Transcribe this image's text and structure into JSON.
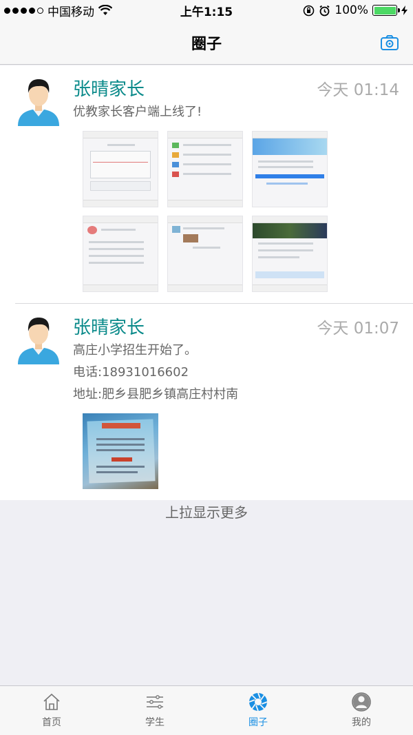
{
  "status_bar": {
    "carrier": "中国移动",
    "time": "上午1:15",
    "battery": "100%"
  },
  "nav": {
    "title": "圈子",
    "camera_icon": "camera-icon"
  },
  "posts": [
    {
      "author": "张晴家长",
      "time": "今天 01:14",
      "lines": [
        "优教家长客户端上线了!"
      ]
    },
    {
      "author": "张晴家长",
      "time": "今天 01:07",
      "lines": [
        "高庄小学招生开始了。",
        "电话:18931016602",
        "地址:肥乡县肥乡镇高庄村村南"
      ]
    }
  ],
  "load_more": "上拉显示更多",
  "tabs": [
    {
      "label": "首页",
      "icon": "home-icon",
      "active": false
    },
    {
      "label": "学生",
      "icon": "sliders-icon",
      "active": false
    },
    {
      "label": "圈子",
      "icon": "aperture-icon",
      "active": true
    },
    {
      "label": "我的",
      "icon": "user-icon",
      "active": false
    }
  ],
  "colors": {
    "accent": "#1a8fe3",
    "author": "#0a8a8a"
  }
}
